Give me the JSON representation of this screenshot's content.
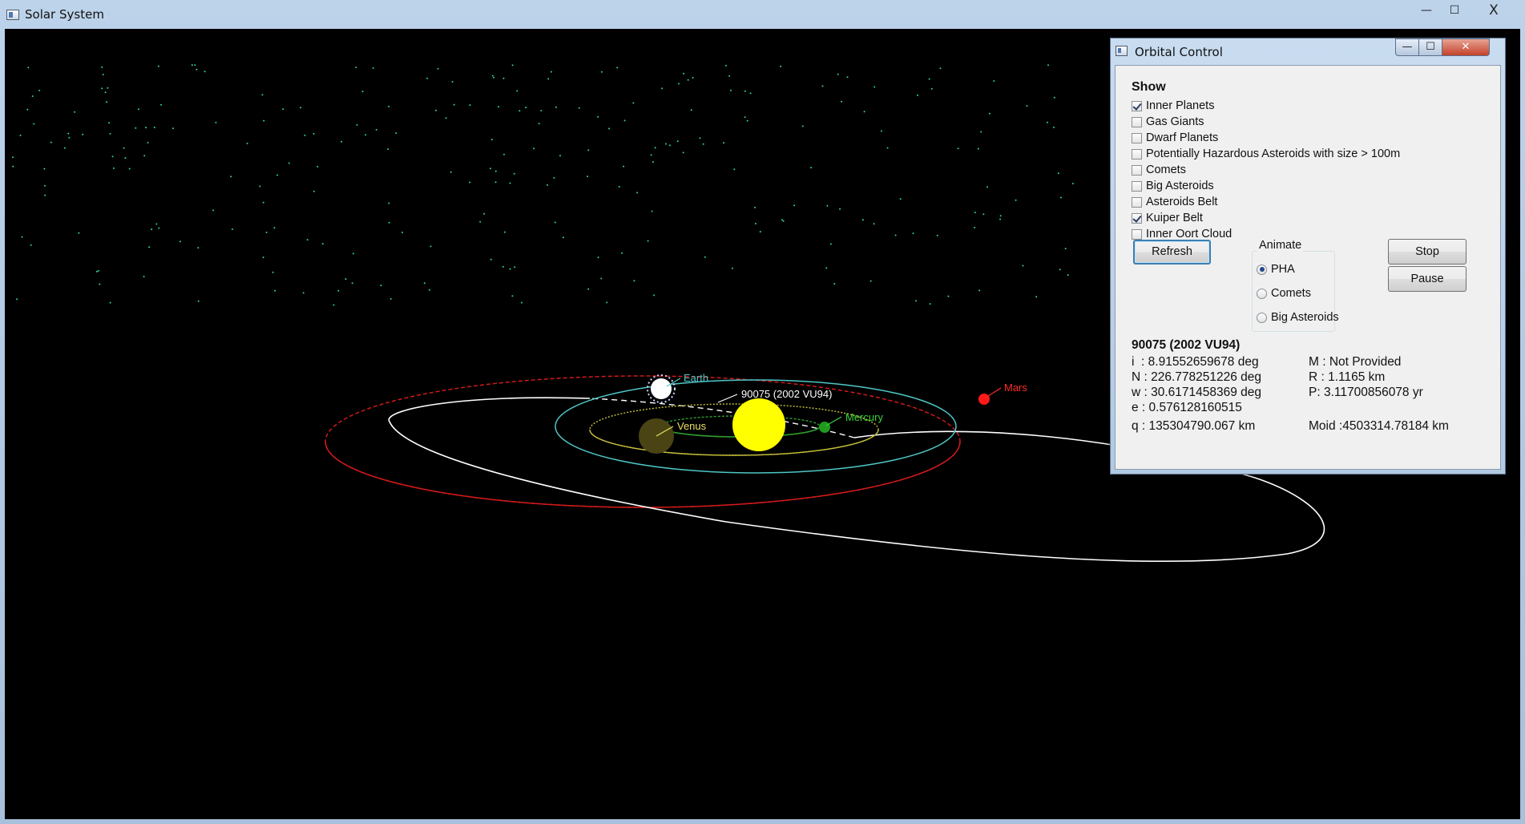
{
  "main_window": {
    "title": "Solar System",
    "controls": {
      "minimize": "—",
      "maximize": "☐",
      "close": "X"
    }
  },
  "scene": {
    "labels": {
      "earth": "Earth",
      "asteroid": "90075 (2002 VU94)",
      "venus": "Venus",
      "mercury": "Mercury",
      "mars": "Mars"
    },
    "colors": {
      "background": "#000000",
      "stars": "#2fd3a8",
      "sun": "#ffff00",
      "earth_orbit": "#4fc6c6",
      "venus_orbit": "#c9c23a",
      "mercury_orbit": "#2e9b2e",
      "mars_orbit": "#d01a1a",
      "asteroid_orbit": "#ffffff",
      "mars": "#ff1a1a",
      "mercury": "#1f9a1f",
      "venus": "#4a4414",
      "earth": "#ffffff"
    }
  },
  "orbital_control": {
    "title": "Orbital Control",
    "window_controls": {
      "minimize": "—",
      "maximize": "☐",
      "close": "✕"
    },
    "show": {
      "heading": "Show",
      "options": [
        {
          "label": "Inner Planets",
          "checked": true
        },
        {
          "label": "Gas Giants",
          "checked": false
        },
        {
          "label": "Dwarf Planets",
          "checked": false
        },
        {
          "label": "Potentially Hazardous Asteroids with size > 100m",
          "checked": false
        },
        {
          "label": "Comets",
          "checked": false
        },
        {
          "label": "Big Asteroids",
          "checked": false
        },
        {
          "label": "Asteroids Belt",
          "checked": false
        },
        {
          "label": "Kuiper Belt",
          "checked": true
        },
        {
          "label": "Inner Oort Cloud",
          "checked": false
        }
      ]
    },
    "refresh_label": "Refresh",
    "animate": {
      "legend": "Animate",
      "options": [
        {
          "label": "PHA",
          "selected": true
        },
        {
          "label": "Comets",
          "selected": false
        },
        {
          "label": "Big Asteroids",
          "selected": false
        }
      ]
    },
    "stop_label": "Stop",
    "pause_label": "Pause",
    "selected_body": {
      "name": "90075 (2002 VU94)",
      "i": "i  : 8.91552659678 deg",
      "n": "N : 226.778251226 deg",
      "w": "w : 30.6171458369 deg",
      "e": "e : 0.576128160515",
      "q": "q : 135304790.067 km",
      "m": "M : Not Provided",
      "r": "R : 1.1165 km",
      "p": "P: 3.11700856078 yr",
      "moid": "Moid :4503314.78184 km"
    }
  }
}
